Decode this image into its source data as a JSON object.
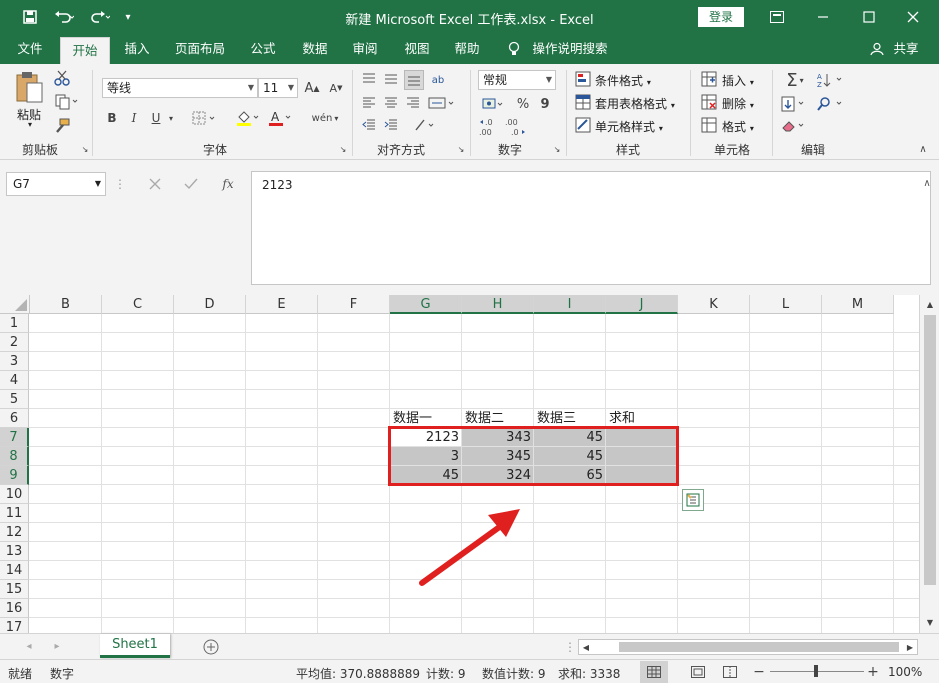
{
  "titlebar": {
    "title": "新建 Microsoft Excel 工作表.xlsx  -  Excel",
    "login": "登录",
    "bg": "#217346"
  },
  "menu": [
    "文件",
    "开始",
    "插入",
    "页面布局",
    "公式",
    "数据",
    "审阅",
    "视图",
    "帮助"
  ],
  "menu_active": "开始",
  "tell_me": "操作说明搜索",
  "share": "共享",
  "ribbon": {
    "clipboard": {
      "paste": "粘贴",
      "label": "剪贴板"
    },
    "font": {
      "name": "等线",
      "size": "11",
      "label": "字体",
      "bold": "B",
      "italic": "I",
      "underline": "U",
      "grow": "A",
      "shrink": "A",
      "phonetic": "wén"
    },
    "alignment": {
      "label": "对齐方式",
      "wrap": "ab"
    },
    "number": {
      "format": "常规",
      "label": "数字",
      "percent": "%",
      "comma": "9",
      "inc": "←.0 .00",
      "dec": ".00 →.0"
    },
    "styles": {
      "conditional": "条件格式",
      "table": "套用表格格式",
      "cell": "单元格样式",
      "label": "样式"
    },
    "cells": {
      "insert": "插入",
      "delete": "删除",
      "format": "格式",
      "label": "单元格"
    },
    "editing": {
      "label": "编辑"
    }
  },
  "formula_bar": {
    "name_box": "G7",
    "formula": "2123",
    "fx": "fx"
  },
  "columns": [
    "B",
    "C",
    "D",
    "E",
    "F",
    "G",
    "H",
    "I",
    "J",
    "K",
    "L",
    "M"
  ],
  "rows": [
    "1",
    "2",
    "3",
    "4",
    "5",
    "6",
    "7",
    "8",
    "9",
    "10",
    "11",
    "12",
    "13",
    "14",
    "15",
    "16",
    "17"
  ],
  "headers_row6": {
    "G": "数据一",
    "H": "数据二",
    "I": "数据三",
    "J": "求和"
  },
  "data": {
    "r7": {
      "G": "2123",
      "H": "343",
      "I": "45"
    },
    "r8": {
      "G": "3",
      "H": "345",
      "I": "45"
    },
    "r9": {
      "G": "45",
      "H": "324",
      "I": "65"
    }
  },
  "sheet_tabs": [
    "Sheet1"
  ],
  "status": {
    "ready": "就绪",
    "mode": "数字",
    "average": "平均值: 370.8888889",
    "count": "计数: 9",
    "numcount": "数值计数: 9",
    "sum": "求和: 3338",
    "zoom": "100%"
  },
  "colors": {
    "accent": "#217346",
    "highlight_border": "#e0201f",
    "selection_fill": "#c6c6c6"
  }
}
